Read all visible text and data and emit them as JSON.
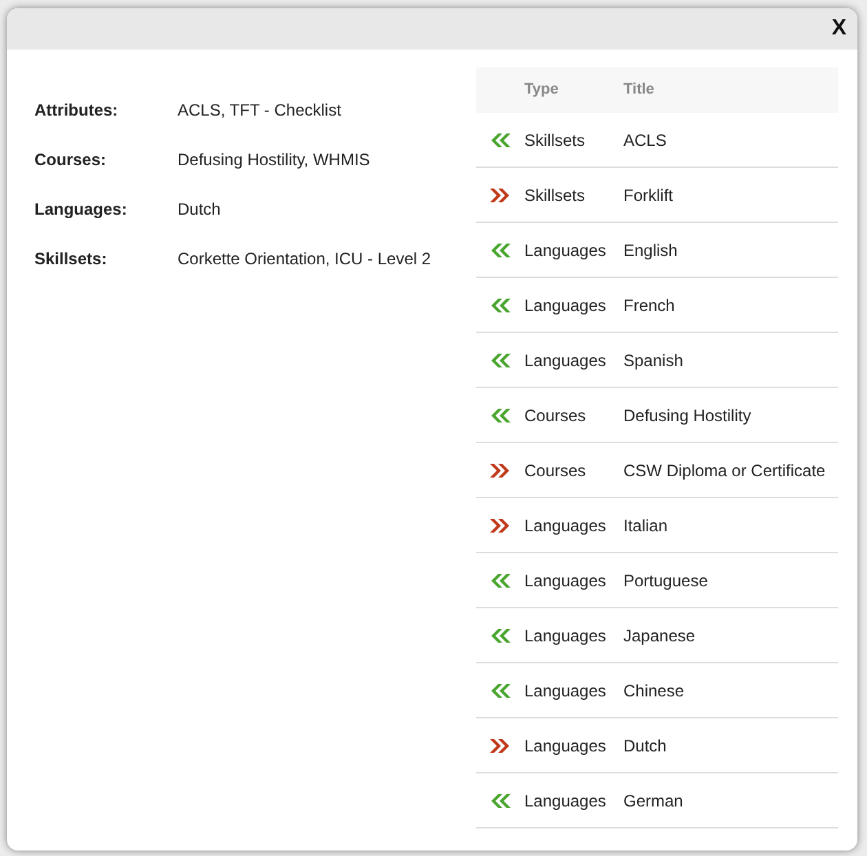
{
  "dialog": {
    "close": "X"
  },
  "details": [
    {
      "label": "Attributes:",
      "value": "ACLS, TFT - Checklist"
    },
    {
      "label": "Courses:",
      "value": "Defusing Hostility, WHMIS"
    },
    {
      "label": "Languages:",
      "value": "Dutch"
    },
    {
      "label": "Skillsets:",
      "value": "Corkette Orientation, ICU - Level 2"
    }
  ],
  "table": {
    "columns": [
      "Type",
      "Title"
    ],
    "rows": [
      {
        "kind": "left",
        "type": "Skillsets",
        "title": "ACLS"
      },
      {
        "kind": "right",
        "type": "Skillsets",
        "title": "Forklift"
      },
      {
        "kind": "left",
        "type": "Languages",
        "title": "English"
      },
      {
        "kind": "left",
        "type": "Languages",
        "title": "French"
      },
      {
        "kind": "left",
        "type": "Languages",
        "title": "Spanish"
      },
      {
        "kind": "left",
        "type": "Courses",
        "title": "Defusing Hostility"
      },
      {
        "kind": "right",
        "type": "Courses",
        "title": "CSW Diploma or Certificate"
      },
      {
        "kind": "right",
        "type": "Languages",
        "title": "Italian"
      },
      {
        "kind": "left",
        "type": "Languages",
        "title": "Portuguese"
      },
      {
        "kind": "left",
        "type": "Languages",
        "title": "Japanese"
      },
      {
        "kind": "left",
        "type": "Languages",
        "title": "Chinese"
      },
      {
        "kind": "right",
        "type": "Languages",
        "title": "Dutch"
      },
      {
        "kind": "left",
        "type": "Languages",
        "title": "German"
      }
    ]
  }
}
